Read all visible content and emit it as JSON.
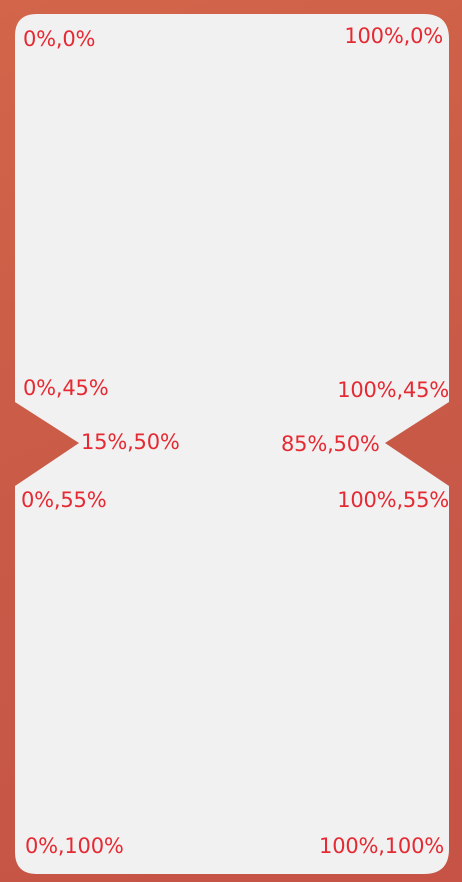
{
  "colors": {
    "background": "#c9594a",
    "panel": "#f1f1f1",
    "label_text": "#e52a33"
  },
  "labels": {
    "top_left": "0%,0%",
    "top_right": "100%,0%",
    "mid_left_upper": "0%,45%",
    "mid_right_upper": "100%,45%",
    "notch_left_tip": "15%,50%",
    "notch_right_tip": "85%,50%",
    "mid_left_lower": "0%,55%",
    "mid_right_lower": "100%,55%",
    "bottom_left": "0%,100%",
    "bottom_right": "100%,100%"
  }
}
